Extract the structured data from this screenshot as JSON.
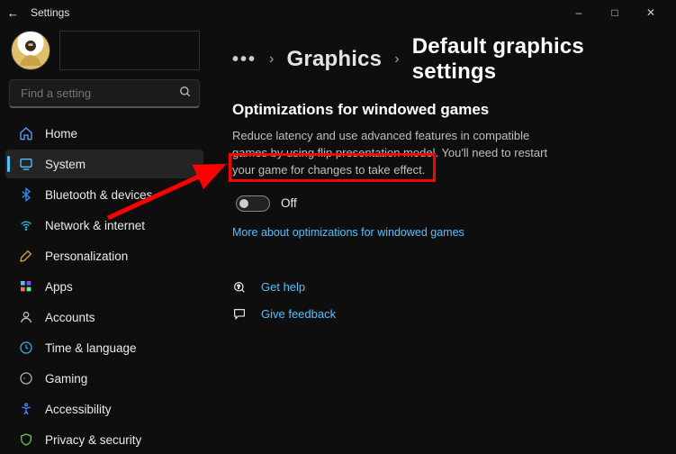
{
  "window": {
    "title": "Settings"
  },
  "profile": {
    "name": ""
  },
  "search": {
    "placeholder": "Find a setting"
  },
  "sidebar": {
    "items": [
      {
        "label": "Home"
      },
      {
        "label": "System"
      },
      {
        "label": "Bluetooth & devices"
      },
      {
        "label": "Network & internet"
      },
      {
        "label": "Personalization"
      },
      {
        "label": "Apps"
      },
      {
        "label": "Accounts"
      },
      {
        "label": "Time & language"
      },
      {
        "label": "Gaming"
      },
      {
        "label": "Accessibility"
      },
      {
        "label": "Privacy & security"
      }
    ],
    "activeIndex": 1
  },
  "breadcrumb": {
    "ellipsis": "•••",
    "level1": "Graphics",
    "level2": "Default graphics settings"
  },
  "section": {
    "title": "Optimizations for windowed games",
    "description": "Reduce latency and use advanced features in compatible games by using flip presentation model. You'll need to restart your game for changes to take effect.",
    "toggleState": "Off",
    "learnMore": "More about optimizations for windowed games"
  },
  "help": {
    "getHelp": "Get help",
    "feedback": "Give feedback"
  }
}
